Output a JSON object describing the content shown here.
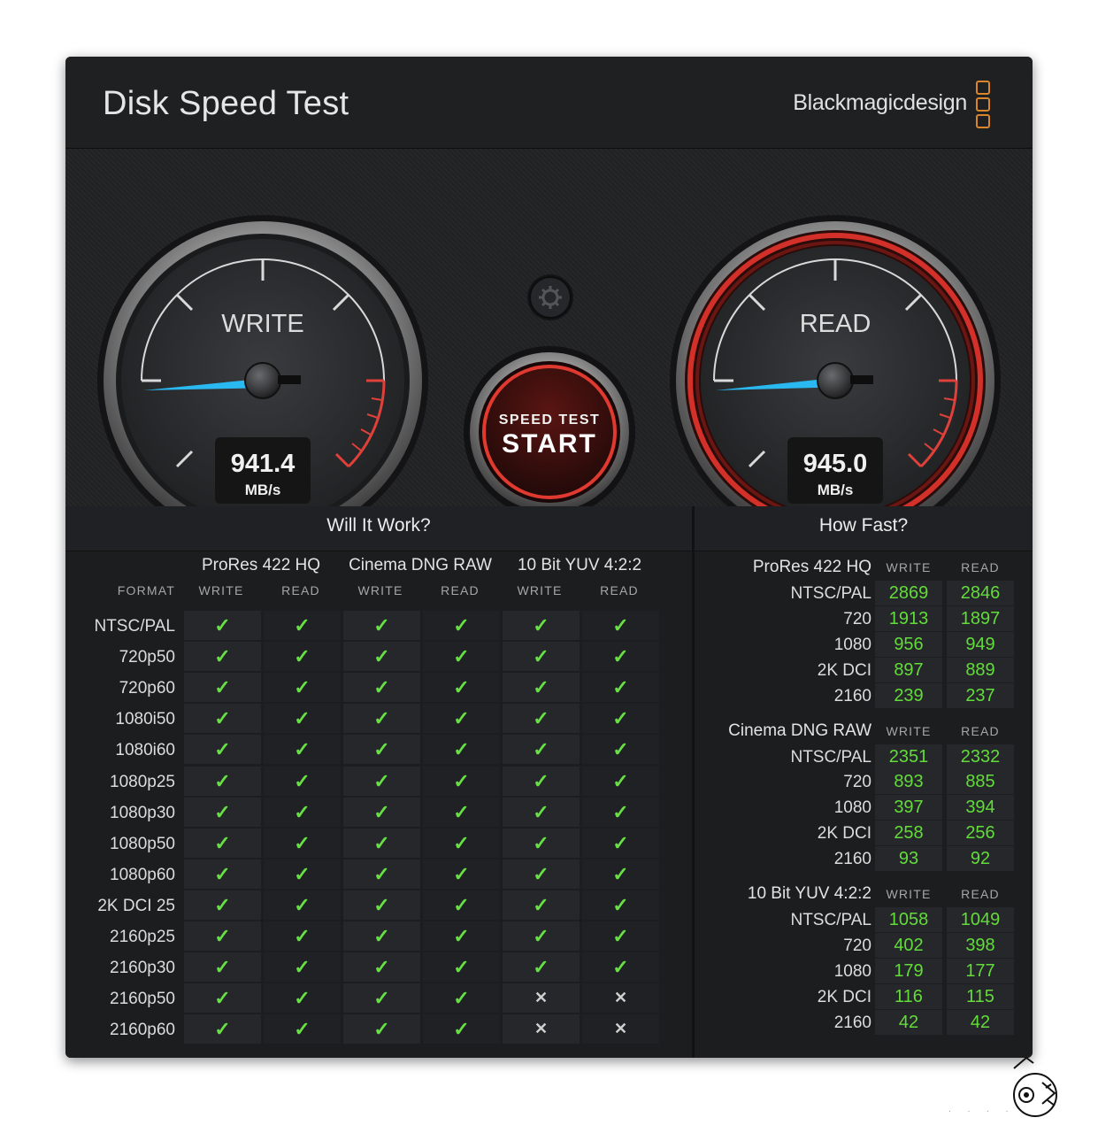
{
  "window": {
    "close_icon": "×",
    "title": "Disk Speed Test",
    "brand": "Blackmagicdesign",
    "brand_accent": "#d9862a"
  },
  "gauges": {
    "write": {
      "label": "WRITE",
      "value": "941.4",
      "unit": "MB/s",
      "needle_color": "#29b8f0"
    },
    "read": {
      "label": "READ",
      "value": "945.0",
      "unit": "MB/s",
      "needle_color": "#29b8f0",
      "ring_color": "#d23028"
    }
  },
  "start_button": {
    "line1": "SPEED TEST",
    "line2": "START",
    "ring_color": "#e03a30"
  },
  "settings_icon": "gear-icon",
  "will_it_work": {
    "title": "Will It Work?",
    "format_label": "FORMAT",
    "groups": [
      "ProRes 422 HQ",
      "Cinema DNG RAW",
      "10 Bit YUV 4:2:2"
    ],
    "write_label": "WRITE",
    "read_label": "READ",
    "check_symbol": "✓",
    "cross_symbol": "✕",
    "rows": [
      {
        "format": "NTSC/PAL",
        "results": [
          true,
          true,
          true,
          true,
          true,
          true
        ]
      },
      {
        "format": "720p50",
        "results": [
          true,
          true,
          true,
          true,
          true,
          true
        ]
      },
      {
        "format": "720p60",
        "results": [
          true,
          true,
          true,
          true,
          true,
          true
        ]
      },
      {
        "format": "1080i50",
        "results": [
          true,
          true,
          true,
          true,
          true,
          true
        ]
      },
      {
        "format": "1080i60",
        "results": [
          true,
          true,
          true,
          true,
          true,
          true
        ]
      },
      {
        "format": "1080p25",
        "results": [
          true,
          true,
          true,
          true,
          true,
          true
        ]
      },
      {
        "format": "1080p30",
        "results": [
          true,
          true,
          true,
          true,
          true,
          true
        ]
      },
      {
        "format": "1080p50",
        "results": [
          true,
          true,
          true,
          true,
          true,
          true
        ]
      },
      {
        "format": "1080p60",
        "results": [
          true,
          true,
          true,
          true,
          true,
          true
        ]
      },
      {
        "format": "2K DCI 25",
        "results": [
          true,
          true,
          true,
          true,
          true,
          true
        ]
      },
      {
        "format": "2160p25",
        "results": [
          true,
          true,
          true,
          true,
          true,
          true
        ]
      },
      {
        "format": "2160p30",
        "results": [
          true,
          true,
          true,
          true,
          true,
          true
        ]
      },
      {
        "format": "2160p50",
        "results": [
          true,
          true,
          true,
          true,
          false,
          false
        ]
      },
      {
        "format": "2160p60",
        "results": [
          true,
          true,
          true,
          true,
          false,
          false
        ]
      }
    ]
  },
  "how_fast": {
    "title": "How Fast?",
    "write_label": "WRITE",
    "read_label": "READ",
    "groups": [
      {
        "name": "ProRes 422 HQ",
        "rows": [
          {
            "format": "NTSC/PAL",
            "write": "2869",
            "read": "2846"
          },
          {
            "format": "720",
            "write": "1913",
            "read": "1897"
          },
          {
            "format": "1080",
            "write": "956",
            "read": "949"
          },
          {
            "format": "2K DCI",
            "write": "897",
            "read": "889"
          },
          {
            "format": "2160",
            "write": "239",
            "read": "237"
          }
        ]
      },
      {
        "name": "Cinema DNG RAW",
        "rows": [
          {
            "format": "NTSC/PAL",
            "write": "2351",
            "read": "2332"
          },
          {
            "format": "720",
            "write": "893",
            "read": "885"
          },
          {
            "format": "1080",
            "write": "397",
            "read": "394"
          },
          {
            "format": "2K DCI",
            "write": "258",
            "read": "256"
          },
          {
            "format": "2160",
            "write": "93",
            "read": "92"
          }
        ]
      },
      {
        "name": "10 Bit YUV 4:2:2",
        "rows": [
          {
            "format": "NTSC/PAL",
            "write": "1058",
            "read": "1049"
          },
          {
            "format": "720",
            "write": "402",
            "read": "398"
          },
          {
            "format": "1080",
            "write": "179",
            "read": "177"
          },
          {
            "format": "2K DCI",
            "write": "116",
            "read": "115"
          },
          {
            "format": "2160",
            "write": "42",
            "read": "42"
          }
        ]
      }
    ]
  }
}
